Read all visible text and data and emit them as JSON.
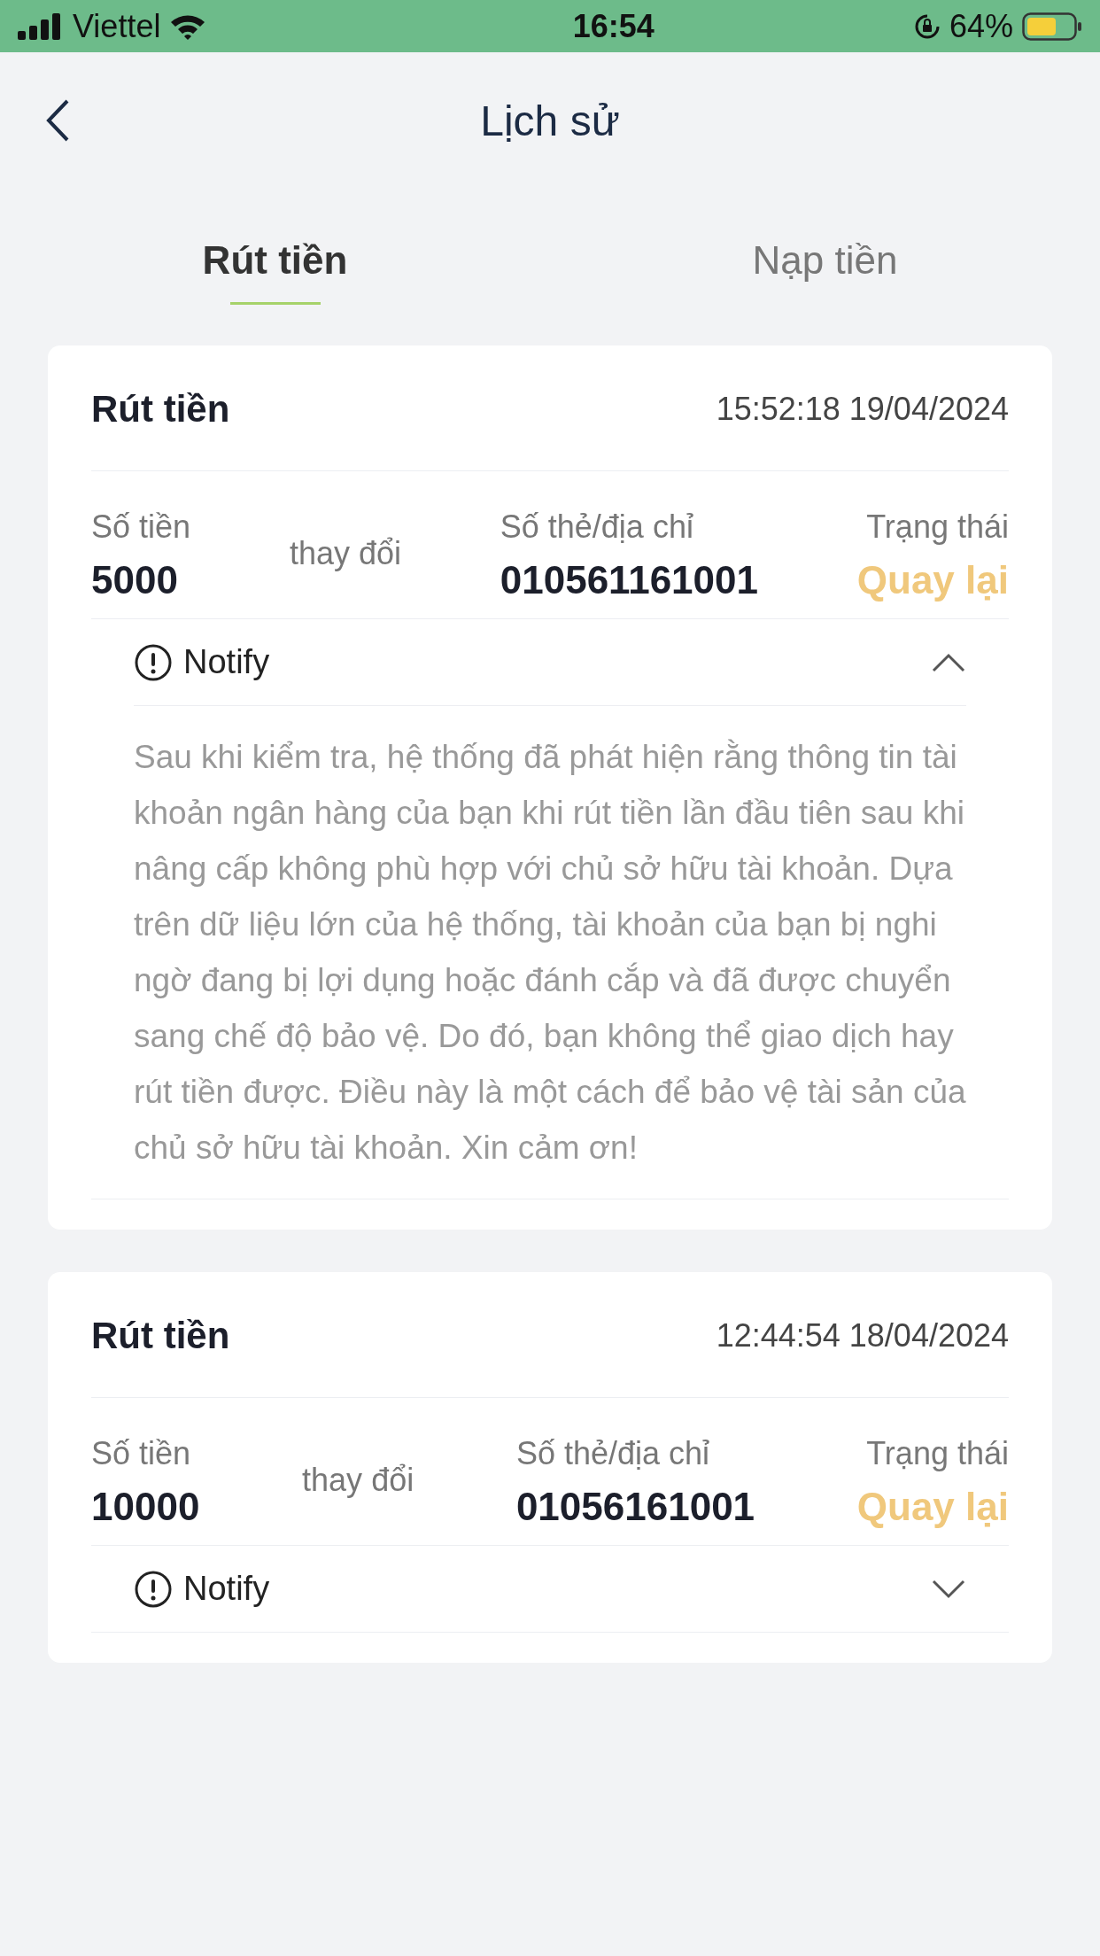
{
  "status_bar": {
    "carrier": "Viettel",
    "time": "16:54",
    "battery": "64%"
  },
  "header": {
    "title": "Lịch sử"
  },
  "tabs": [
    {
      "label": "Rút tiền",
      "selected": true
    },
    {
      "label": "Nạp tiền",
      "selected": false
    }
  ],
  "records": [
    {
      "title": "Rút tiền",
      "datetime": "15:52:18 19/04/2024",
      "amount_label": "Số tiền",
      "amount": "5000",
      "change": "thay đổi",
      "card_label": "Số thẻ/địa chỉ",
      "card": "010561161001",
      "status_label": "Trạng thái",
      "status": "Quay lại",
      "notify": {
        "label": "Notify",
        "expanded": true,
        "message": "Sau khi kiểm tra, hệ thống đã phát hiện rằng thông tin tài khoản ngân hàng của bạn khi rút tiền lần đầu tiên sau khi nâng cấp không phù hợp với chủ sở hữu tài khoản. Dựa trên dữ liệu lớn của hệ thống, tài khoản của bạn bị nghi ngờ đang bị lợi dụng hoặc đánh cắp và đã được chuyển sang chế độ bảo vệ. Do đó, bạn không thể giao dịch hay rút tiền được. Điều này là một cách để bảo vệ tài sản của chủ sở hữu tài khoản. Xin cảm ơn!"
      }
    },
    {
      "title": "Rút tiền",
      "datetime": "12:44:54 18/04/2024",
      "amount_label": "Số tiền",
      "amount": "10000",
      "change": "thay đổi",
      "card_label": "Số thẻ/địa chỉ",
      "card": "01056161001",
      "status_label": "Trạng thái",
      "status": "Quay lại",
      "notify": {
        "label": "Notify",
        "expanded": false
      }
    }
  ]
}
